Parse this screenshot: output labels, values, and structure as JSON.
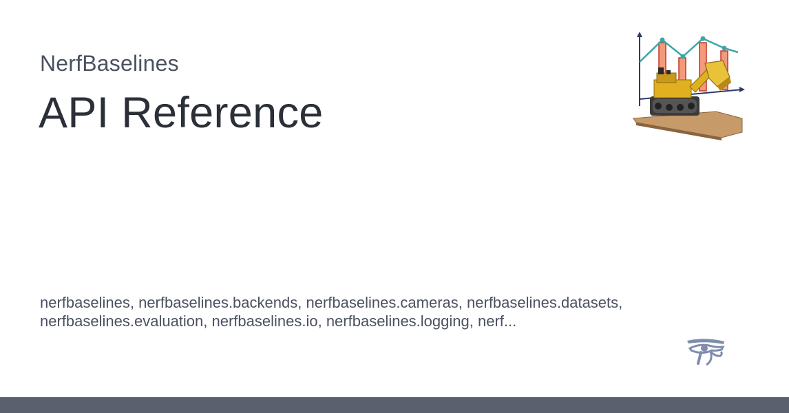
{
  "site": {
    "name": "NerfBaselines"
  },
  "page": {
    "title": "API Reference"
  },
  "summary": {
    "line1": "nerfbaselines, nerfbaselines.backends, nerfbaselines.cameras, nerfbaselines.datasets,",
    "line2": "nerfbaselines.evaluation, nerfbaselines.io, nerfbaselines.logging, nerf..."
  },
  "icons": {
    "logo": "nerfbaselines-logo-icon",
    "footer": "eye-of-horus-icon"
  },
  "colors": {
    "title": "#2b2f37",
    "text": "#4b5160",
    "footer_bar": "#5a606d",
    "chart_line": "#3aa6a8",
    "chart_bar": "#f39a7a",
    "eye": "#7f8dad"
  }
}
